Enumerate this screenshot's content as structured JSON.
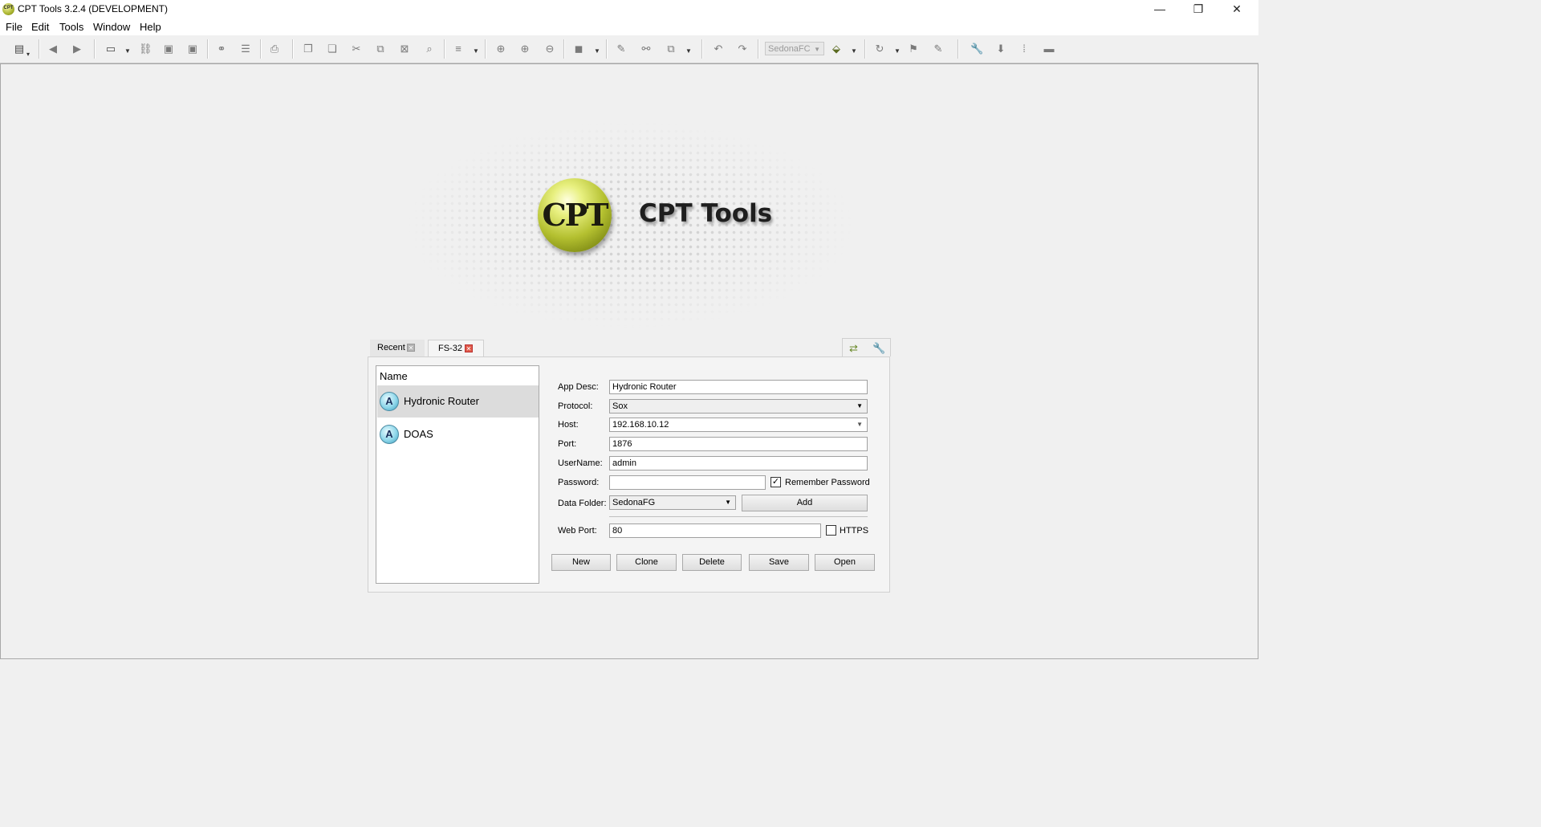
{
  "window": {
    "title": "CPT Tools 3.2.4 (DEVELOPMENT)",
    "app_icon_text": "CPT",
    "minimize": "—",
    "restore": "❐",
    "close": "✕"
  },
  "menu": [
    "File",
    "Edit",
    "Tools",
    "Window",
    "Help"
  ],
  "toolbar": {
    "station_combo": "SedonaFC"
  },
  "splash": {
    "logo_text": "CPT",
    "title": "CPT Tools"
  },
  "tabs": [
    {
      "label": "Recent",
      "close": "✕"
    },
    {
      "label": "FS-32",
      "close": "✕"
    }
  ],
  "app_list": {
    "header": "Name",
    "items": [
      {
        "badge": "A",
        "label": "Hydronic Router",
        "selected": true
      },
      {
        "badge": "A",
        "label": "DOAS",
        "selected": false
      }
    ]
  },
  "form": {
    "app_desc_label": "App Desc:",
    "app_desc_value": "Hydronic Router",
    "protocol_label": "Protocol:",
    "protocol_value": "Sox",
    "host_label": "Host:",
    "host_value": "192.168.10.12",
    "port_label": "Port:",
    "port_value": "1876",
    "username_label": "UserName:",
    "username_value": "admin",
    "password_label": "Password:",
    "password_value": "",
    "remember_password_label": "Remember Password",
    "remember_password_checked": true,
    "data_folder_label": "Data Folder:",
    "data_folder_value": "SedonaFG",
    "add_button": "Add",
    "web_port_label": "Web Port:",
    "web_port_value": "80",
    "https_label": "HTTPS",
    "https_checked": false
  },
  "actions": [
    "New",
    "Clone",
    "Delete",
    "Save",
    "Open"
  ],
  "glyphs": {
    "check": "✓",
    "dropdown": "▼"
  }
}
